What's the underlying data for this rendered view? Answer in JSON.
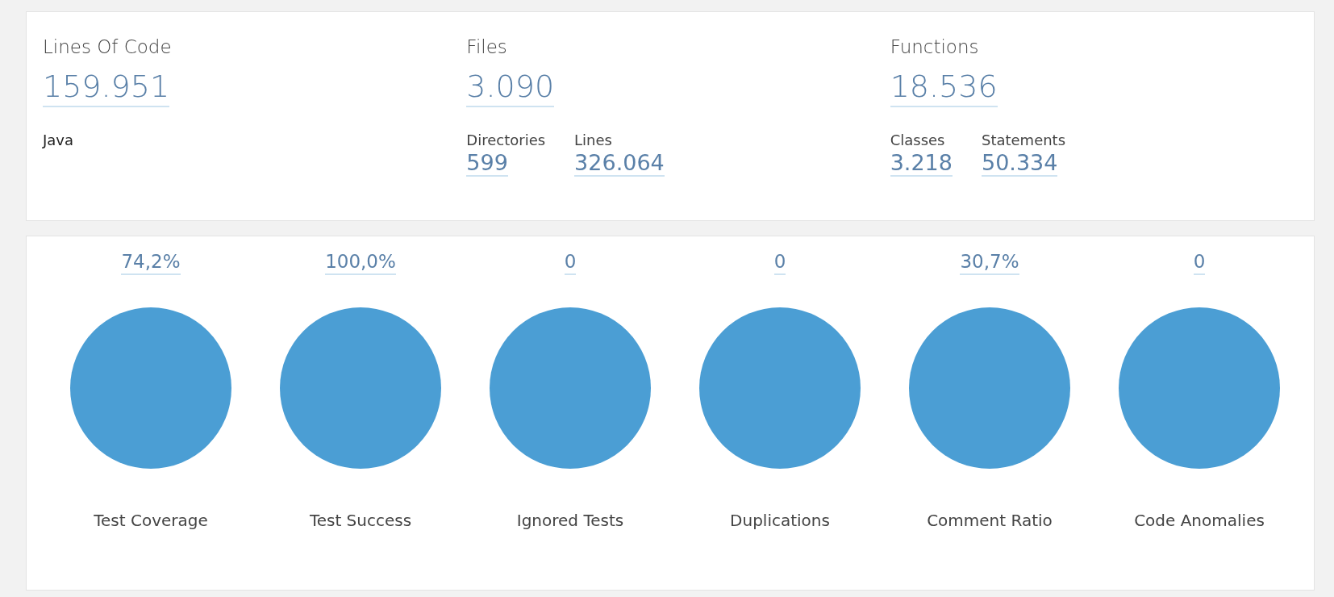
{
  "summary": [
    {
      "label": "Lines Of Code",
      "value": "159.951",
      "note": "Java"
    },
    {
      "label": "Files",
      "value": "3.090",
      "subs": [
        {
          "label": "Directories",
          "value": "599"
        },
        {
          "label": "Lines",
          "value": "326.064"
        }
      ]
    },
    {
      "label": "Functions",
      "value": "18.536",
      "subs": [
        {
          "label": "Classes",
          "value": "3.218"
        },
        {
          "label": "Statements",
          "value": "50.334"
        }
      ]
    }
  ],
  "metrics": [
    {
      "value": "74,2%",
      "label": "Test Coverage"
    },
    {
      "value": "100,0%",
      "label": "Test Success"
    },
    {
      "value": "0",
      "label": "Ignored Tests"
    },
    {
      "value": "0",
      "label": "Duplications"
    },
    {
      "value": "30,7%",
      "label": "Comment Ratio"
    },
    {
      "value": "0",
      "label": "Code Anomalies"
    }
  ]
}
